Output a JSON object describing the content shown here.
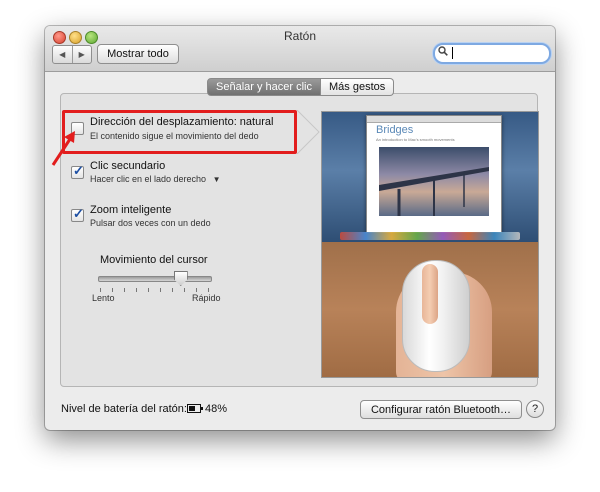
{
  "window": {
    "title": "Ratón"
  },
  "toolbar": {
    "back_glyph": "◀",
    "forward_glyph": "▶",
    "show_all_label": "Mostrar todo",
    "search": {
      "value": "",
      "icon": "search-icon"
    }
  },
  "tabs": [
    {
      "label": "Señalar y hacer clic",
      "selected": true
    },
    {
      "label": "Más gestos",
      "selected": false
    }
  ],
  "options": [
    {
      "title": "Dirección del desplazamiento: natural",
      "description": "El contenido sigue el movimiento del dedo",
      "checked": false
    },
    {
      "title": "Clic secundario",
      "description": "Hacer clic en el lado derecho",
      "checked": true
    },
    {
      "title": "Zoom inteligente",
      "description": "Pulsar dos veces con un dedo",
      "checked": true
    }
  ],
  "cursor_speed": {
    "label": "Movimiento del cursor",
    "min_label": "Lento",
    "max_label": "Rápido",
    "value_fraction": 0.73
  },
  "preview": {
    "doc_title": "Bridges",
    "doc_subtitle": "An introduction to Mac's smooth movements"
  },
  "footer": {
    "battery_label": "Nivel de batería del ratón:",
    "battery_value": "48%",
    "bt_button_label": "Configurar ratón Bluetooth…",
    "help_glyph": "?"
  },
  "colors": {
    "highlight_box": "#e21d1d",
    "check": "#1d4fa3"
  }
}
